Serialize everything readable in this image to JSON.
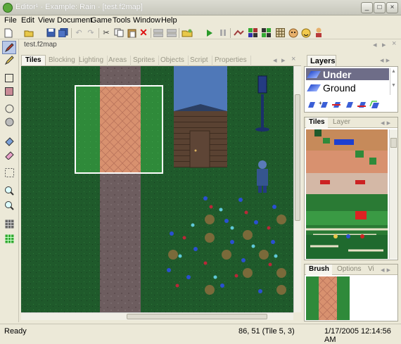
{
  "window": {
    "title": "Editor¹ - Example: Rain - [test.f2map]",
    "controls": {
      "minimize": "_",
      "maximize": "□",
      "close": "×"
    }
  },
  "menu": {
    "items": [
      "File",
      "Edit",
      "View",
      "Document",
      "Game",
      "Tools",
      "Window",
      "Help"
    ]
  },
  "toolbar": {
    "icons": [
      "new-icon",
      "open-icon",
      "save-icon",
      "save-all-icon",
      "undo-icon",
      "redo-icon",
      "cut-icon",
      "copy-icon",
      "paste-icon",
      "delete-icon",
      "grid-icon",
      "grid-alt-icon",
      "plugin-icon",
      "play-icon",
      "pause-icon",
      "walk-icon",
      "tileset-icon",
      "sprites-icon",
      "grid-small-icon",
      "face1-icon",
      "face2-icon",
      "character-icon"
    ]
  },
  "document_tab": {
    "label": "test.f2map"
  },
  "left_tools": {
    "icons": [
      "pencil-icon",
      "rectangle-icon",
      "filled-rectangle-icon",
      "ellipse-icon",
      "filled-ellipse-icon",
      "fill-icon",
      "eraser-icon",
      "select-icon",
      "zoom-in-icon",
      "zoom-out-icon",
      "grid-toggle-icon",
      "grid-color-icon"
    ]
  },
  "map_tabs": [
    "Tiles",
    "Blocking",
    "Lighting",
    "Areas",
    "Sprites",
    "Objects",
    "Script",
    "Properties"
  ],
  "map_tab_active": "Tiles",
  "layers_panel": {
    "title": "Layers",
    "layers": [
      {
        "name": "Under",
        "selected": true
      },
      {
        "name": "Ground",
        "selected": false
      }
    ]
  },
  "tiles_panel": {
    "tabs": [
      "Tiles",
      "Layer"
    ],
    "active": "Tiles"
  },
  "brush_panel": {
    "tabs": [
      "Brush",
      "Options",
      "Vi"
    ],
    "active": "Brush"
  },
  "status": {
    "left": "Ready",
    "position": "86, 51 (Tile 5, 3)",
    "datetime": "1/17/2005 12:14:56 AM"
  },
  "colors": {
    "grass": "#1f5a2b",
    "path": "#6a5a5a",
    "sand": "#d89a7a",
    "selection": "#ffffff",
    "layer_selected": "#6e6d88"
  }
}
